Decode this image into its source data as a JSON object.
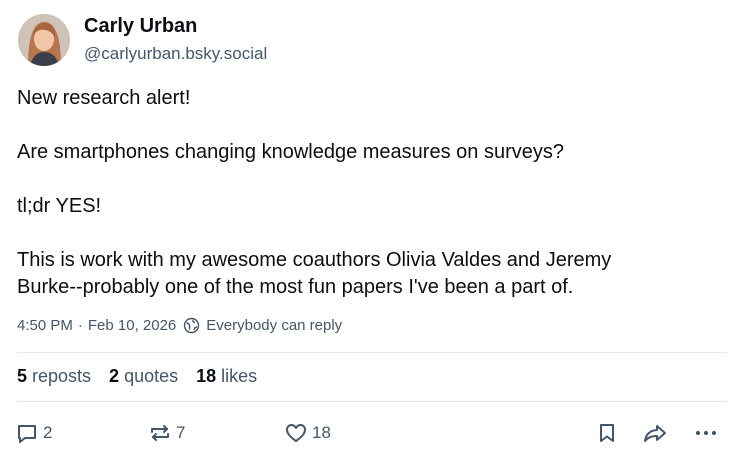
{
  "author": {
    "display_name": "Carly Urban",
    "handle": "@carlyurban.bsky.social",
    "avatar_icon": "profile-photo"
  },
  "post": {
    "paragraphs": [
      [
        "New research alert!"
      ],
      [
        "Are smartphones changing knowledge measures on surveys?"
      ],
      [
        "tl;dr YES!"
      ],
      [
        "This is work with my awesome coauthors Olivia Valdes and Jeremy",
        "Burke--probably one of the most fun papers I've been a part of."
      ]
    ],
    "time": "4:50 PM",
    "separator": "·",
    "date": "Feb 10, 2026",
    "reply_setting": "Everybody can reply",
    "reply_setting_icon": "globe-icon"
  },
  "stats": {
    "reposts_count": "5",
    "reposts_label": "reposts",
    "quotes_count": "2",
    "quotes_label": "quotes",
    "likes_count": "18",
    "likes_label": "likes"
  },
  "actions": {
    "reply_count": "2",
    "repost_count": "7",
    "like_count": "18",
    "icons": [
      "reply-icon",
      "repost-icon",
      "heart-icon",
      "bookmark-icon",
      "share-icon",
      "more-icon"
    ]
  },
  "colors": {
    "text": "#0b0f14",
    "secondary": "#42576c",
    "divider": "#e4e8ec"
  }
}
